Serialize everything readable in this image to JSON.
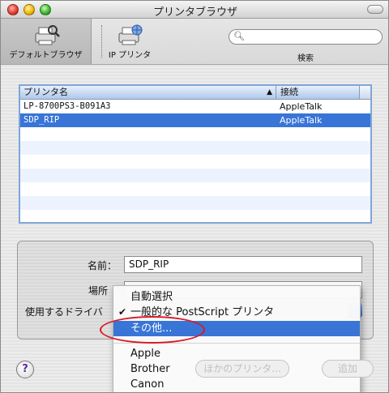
{
  "window": {
    "title": "プリンタブラウザ"
  },
  "toolbar": {
    "default_browser_label": "デフォルトブラウザ",
    "ip_printer_label": "IP プリンタ",
    "search_label": "検索",
    "search_placeholder": ""
  },
  "printer_list": {
    "columns": {
      "name": "プリンタ名",
      "connection": "接続"
    },
    "rows": [
      {
        "name": "LP-8700PS3-B091A3",
        "connection": "AppleTalk",
        "selected": false
      },
      {
        "name": "SDP_RIP",
        "connection": "AppleTalk",
        "selected": true
      }
    ]
  },
  "details": {
    "name_label": "名前：",
    "name_value": "SDP_RIP",
    "location_label": "場所",
    "driver_label": "使用するドライバ"
  },
  "driver_menu": {
    "auto": "自動選択",
    "generic": "一般的な PostScript プリンタ",
    "other": "その他...",
    "vendors": [
      "Apple",
      "Brother",
      "Canon"
    ]
  },
  "bottom": {
    "help": "?",
    "more_printers": "ほかのプリンタ...",
    "add": "追加"
  },
  "colors": {
    "selection": "#3875d7",
    "annotation_ellipse": "#d81b24"
  }
}
